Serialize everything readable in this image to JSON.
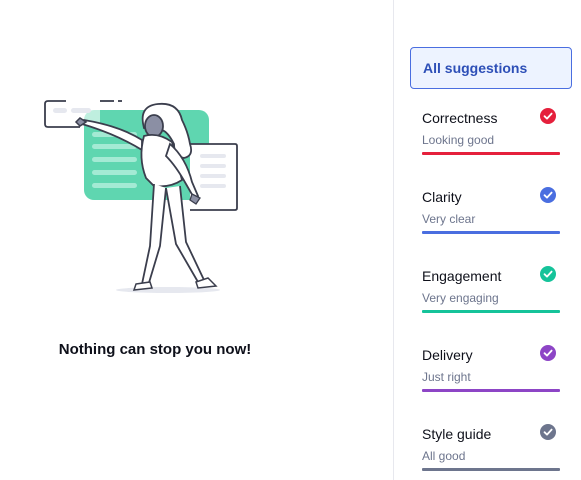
{
  "main": {
    "empty_message": "Nothing can stop you now!"
  },
  "sidebar": {
    "all_suggestions_label": "All suggestions",
    "categories": [
      {
        "title": "Correctness",
        "status": "Looking good",
        "color": "#e5203c",
        "icon": "check-circle-icon"
      },
      {
        "title": "Clarity",
        "status": "Very clear",
        "color": "#4a6ee0",
        "icon": "check-circle-icon"
      },
      {
        "title": "Engagement",
        "status": "Very engaging",
        "color": "#15c39a",
        "icon": "check-circle-icon"
      },
      {
        "title": "Delivery",
        "status": "Just right",
        "color": "#8d45c6",
        "icon": "check-circle-icon"
      },
      {
        "title": "Style guide",
        "status": "All good",
        "color": "#6d758d",
        "icon": "check-circle-icon"
      }
    ]
  }
}
